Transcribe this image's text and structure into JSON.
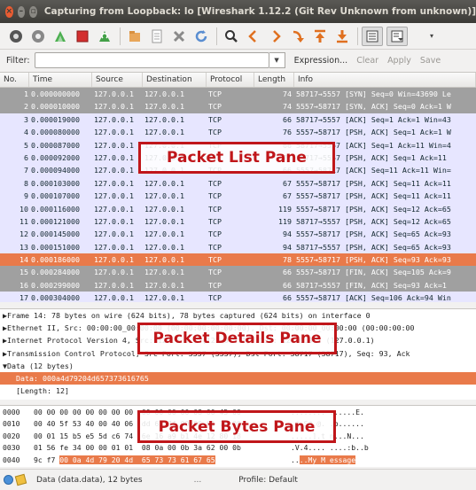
{
  "window": {
    "title": "Capturing from Loopback: lo    [Wireshark 1.12.2  (Git Rev Unknown from unknown)]"
  },
  "toolbar": {
    "icons": [
      "interface-list-icon",
      "capture-options-icon",
      "start-capture-icon",
      "stop-capture-icon",
      "restart-capture-icon",
      "open-file-icon",
      "save-file-icon",
      "close-file-icon",
      "reload-icon",
      "find-icon",
      "go-back-icon",
      "go-forward-icon",
      "go-to-packet-icon",
      "first-packet-icon",
      "last-packet-icon",
      "colorize-icon",
      "autoscroll-icon",
      "more-icon"
    ]
  },
  "filter": {
    "label": "Filter:",
    "value": "",
    "expression": "Expression...",
    "clear": "Clear",
    "apply": "Apply",
    "save": "Save"
  },
  "packet_list": {
    "columns": [
      "No.",
      "Time",
      "Source",
      "Destination",
      "Protocol",
      "Length",
      "Info"
    ],
    "rows": [
      {
        "no": "1",
        "time": "0.000000000",
        "src": "127.0.0.1",
        "dst": "127.0.0.1",
        "proto": "TCP",
        "len": "74",
        "info": "58717→5557 [SYN] Seq=0 Win=43690 Le",
        "bg": "#a0a0a0",
        "fg": "#ffffff"
      },
      {
        "no": "2",
        "time": "0.000010000",
        "src": "127.0.0.1",
        "dst": "127.0.0.1",
        "proto": "TCP",
        "len": "74",
        "info": "5557→58717 [SYN, ACK] Seq=0 Ack=1 W",
        "bg": "#a0a0a0",
        "fg": "#ffffff"
      },
      {
        "no": "3",
        "time": "0.000019000",
        "src": "127.0.0.1",
        "dst": "127.0.0.1",
        "proto": "TCP",
        "len": "66",
        "info": "58717→5557 [ACK] Seq=1 Ack=1 Win=43",
        "bg": "#e7e6ff",
        "fg": "#12272e"
      },
      {
        "no": "4",
        "time": "0.000080000",
        "src": "127.0.0.1",
        "dst": "127.0.0.1",
        "proto": "TCP",
        "len": "76",
        "info": "5557→58717 [PSH, ACK] Seq=1 Ack=1 W",
        "bg": "#e7e6ff",
        "fg": "#12272e"
      },
      {
        "no": "5",
        "time": "0.000087000",
        "src": "127.0.0.1",
        "dst": "127.0.0.1",
        "proto": "TCP",
        "len": "66",
        "info": "58717→5557 [ACK] Seq=1 Ack=11 Win=4",
        "bg": "#e7e6ff",
        "fg": "#12272e"
      },
      {
        "no": "6",
        "time": "0.000092000",
        "src": "127.0.0.1",
        "dst": "127.0.0.1",
        "proto": "TCP",
        "len": "76",
        "info": "58717→5557 [PSH, ACK] Seq=1 Ack=11",
        "bg": "#e7e6ff",
        "fg": "#12272e"
      },
      {
        "no": "7",
        "time": "0.000094000",
        "src": "127.0.0.1",
        "dst": "127.0.0.1",
        "proto": "TCP",
        "len": "66",
        "info": "5557→58717 [ACK] Seq=11 Ack=11 Win=",
        "bg": "#e7e6ff",
        "fg": "#12272e"
      },
      {
        "no": "8",
        "time": "0.000103000",
        "src": "127.0.0.1",
        "dst": "127.0.0.1",
        "proto": "TCP",
        "len": "67",
        "info": "5557→58717 [PSH, ACK] Seq=11 Ack=11",
        "bg": "#e7e6ff",
        "fg": "#12272e"
      },
      {
        "no": "9",
        "time": "0.000107000",
        "src": "127.0.0.1",
        "dst": "127.0.0.1",
        "proto": "TCP",
        "len": "67",
        "info": "5557→58717 [PSH, ACK] Seq=11 Ack=11",
        "bg": "#e7e6ff",
        "fg": "#12272e"
      },
      {
        "no": "10",
        "time": "0.000116000",
        "src": "127.0.0.1",
        "dst": "127.0.0.1",
        "proto": "TCP",
        "len": "119",
        "info": "5557→58717 [PSH, ACK] Seq=12 Ack=65",
        "bg": "#e7e6ff",
        "fg": "#12272e"
      },
      {
        "no": "11",
        "time": "0.000121000",
        "src": "127.0.0.1",
        "dst": "127.0.0.1",
        "proto": "TCP",
        "len": "119",
        "info": "58717→5557 [PSH, ACK] Seq=12 Ack=65",
        "bg": "#e7e6ff",
        "fg": "#12272e"
      },
      {
        "no": "12",
        "time": "0.000145000",
        "src": "127.0.0.1",
        "dst": "127.0.0.1",
        "proto": "TCP",
        "len": "94",
        "info": "5557→58717 [PSH, ACK] Seq=65 Ack=93",
        "bg": "#e7e6ff",
        "fg": "#12272e"
      },
      {
        "no": "13",
        "time": "0.000151000",
        "src": "127.0.0.1",
        "dst": "127.0.0.1",
        "proto": "TCP",
        "len": "94",
        "info": "58717→5557 [PSH, ACK] Seq=65 Ack=93",
        "bg": "#e7e6ff",
        "fg": "#12272e"
      },
      {
        "no": "14",
        "time": "0.000186000",
        "src": "127.0.0.1",
        "dst": "127.0.0.1",
        "proto": "TCP",
        "len": "78",
        "info": "5557→58717 [PSH, ACK] Seq=93 Ack=93",
        "bg": "#e97a4a",
        "fg": "#ffffff"
      },
      {
        "no": "15",
        "time": "0.000284000",
        "src": "127.0.0.1",
        "dst": "127.0.0.1",
        "proto": "TCP",
        "len": "66",
        "info": "5557→58717 [FIN, ACK] Seq=105 Ack=9",
        "bg": "#a0a0a0",
        "fg": "#ffffff"
      },
      {
        "no": "16",
        "time": "0.000299000",
        "src": "127.0.0.1",
        "dst": "127.0.0.1",
        "proto": "TCP",
        "len": "66",
        "info": "58717→5557 [FIN, ACK] Seq=93 Ack=1",
        "bg": "#a0a0a0",
        "fg": "#ffffff"
      },
      {
        "no": "17",
        "time": "0.000304000",
        "src": "127.0.0.1",
        "dst": "127.0.0.1",
        "proto": "TCP",
        "len": "66",
        "info": "5557→58717 [ACK] Seq=106 Ack=94 Win",
        "bg": "#e7e6ff",
        "fg": "#12272e"
      }
    ]
  },
  "details": {
    "rows": [
      {
        "text": "▶Frame 14: 78 bytes on wire (624 bits), 78 bytes captured (624 bits) on interface 0",
        "sel": false,
        "sub": false
      },
      {
        "text": "▶Ethernet II, Src: 00:00:00_00:00:00 (00:00:00:00:00:00), Dst: 00:00:00_00:00:00 (00:00:00:00",
        "sel": false,
        "sub": false
      },
      {
        "text": "▶Internet Protocol Version 4, Src: 127.0.0.1 (127.0.0.1), Dst: 127.0.0.1 (127.0.0.1)",
        "sel": false,
        "sub": false
      },
      {
        "text": "▶Transmission Control Protocol, Src Port: 5557 (5557), Dst Port: 58717 (58717), Seq: 93, Ack",
        "sel": false,
        "sub": false
      },
      {
        "text": "▼Data (12 bytes)",
        "sel": false,
        "sub": false
      },
      {
        "text": "Data: 000a4d79204d657373616765",
        "sel": true,
        "sub": true
      },
      {
        "text": "[Length: 12]",
        "sel": false,
        "sub": true
      }
    ]
  },
  "bytes": {
    "rows": [
      {
        "off": "0000",
        "hex": "00 00 00 00 00 00 00 00  00 00 00 00 08 00 45 00",
        "hl_hex": "",
        "asc": "........ ......E.",
        "hl_asc": ""
      },
      {
        "off": "0010",
        "hex": "00 40 5f 53 40 00 40 06  dd 62 7f 00 00 01 7f 00",
        "hl_hex": "",
        "asc": ".@_S@.@. .b......",
        "hl_asc": ""
      },
      {
        "off": "0020",
        "hex": "00 01 15 b5 e5 5d c6 74  6e 16 a9 b1 4e 12 80 18",
        "hl_hex": "",
        "asc": ".....].t n...N...",
        "hl_asc": ""
      },
      {
        "off": "0030",
        "hex": "01 56 fe 34 00 00 01 01  08 0a 00 0b 3a 62 00 0b",
        "hl_hex": "",
        "asc": ".V.4.... ....:b..b",
        "hl_asc": ""
      },
      {
        "off": "0040",
        "hex": "9c f7 ",
        "hl_hex": "00 0a 4d 79 20 4d  65 73 73 61 67 65",
        "asc": "..",
        "hl_asc": "..My M essage"
      }
    ]
  },
  "status": {
    "text": "Data (data.data), 12 bytes",
    "dots": "...",
    "profile": "Profile: Default"
  },
  "annotations": {
    "list": "Packet List Pane",
    "details": "Packet Details Pane",
    "bytes": "Packet Bytes Pane"
  }
}
